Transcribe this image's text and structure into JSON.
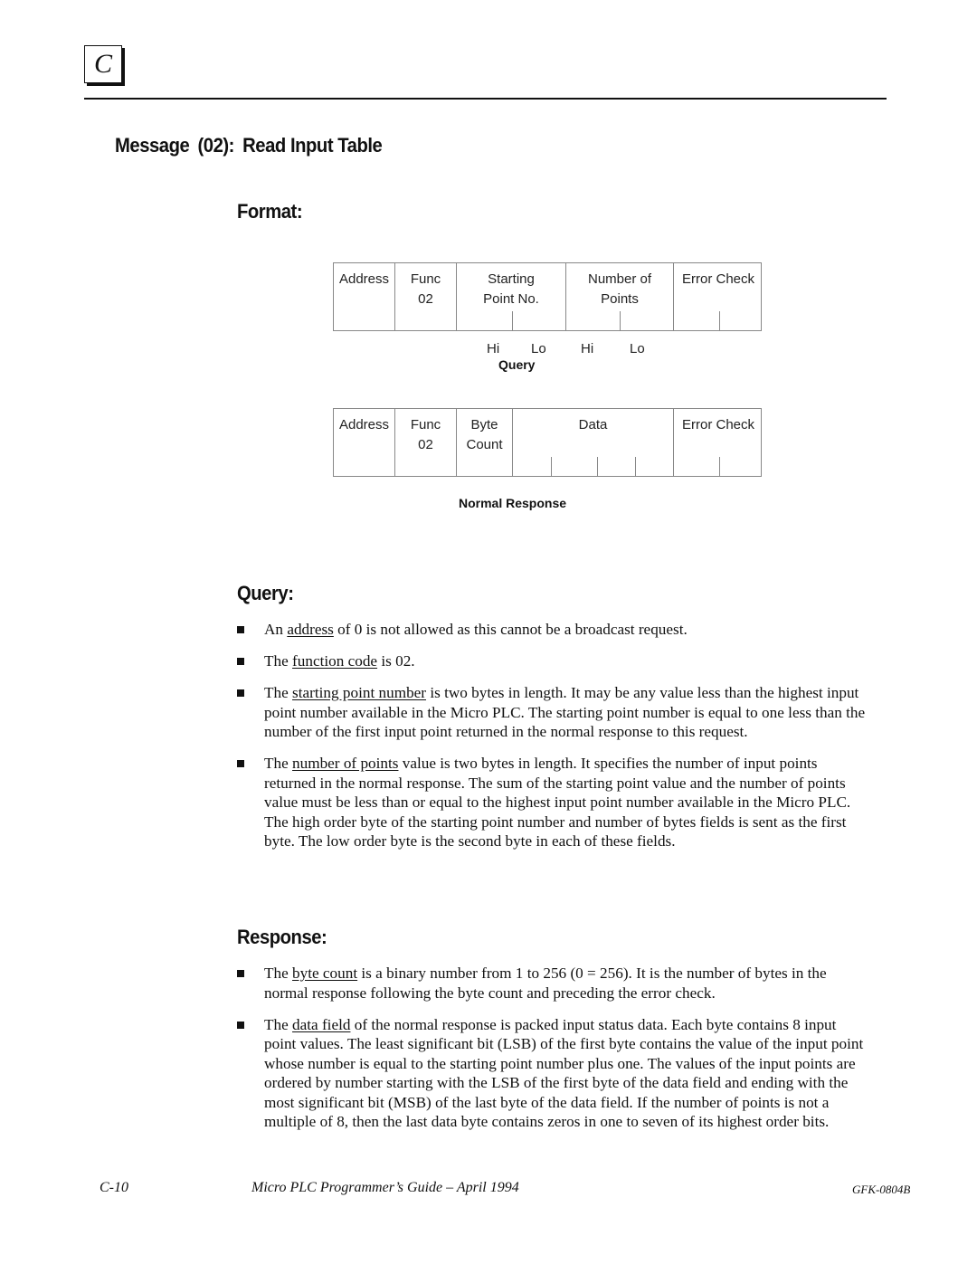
{
  "header": {
    "chapter_letter": "C"
  },
  "title": {
    "part1": "Message",
    "part2": "(02):",
    "part3": "Read Input Table"
  },
  "format_heading": "Format:",
  "query_frame": {
    "cells": [
      {
        "line1": "Address",
        "line2": ""
      },
      {
        "line1": "Func",
        "line2": "02"
      },
      {
        "line1": "Starting",
        "line2": "Point No."
      },
      {
        "line1": "Number of",
        "line2": "Points"
      },
      {
        "line1": "Error Check",
        "line2": ""
      }
    ],
    "byte_labels": [
      "Hi",
      "Lo",
      "Hi",
      "Lo"
    ],
    "caption": "Query"
  },
  "response_frame": {
    "cells": [
      {
        "line1": "Address",
        "line2": ""
      },
      {
        "line1": "Func",
        "line2": "02"
      },
      {
        "line1": "Byte",
        "line2": "Count"
      },
      {
        "line1": "Data",
        "line2": ""
      },
      {
        "line1": "Error Check",
        "line2": ""
      }
    ],
    "caption": "Normal Response"
  },
  "query_section": {
    "heading": "Query:",
    "bullets": [
      {
        "pre": "An ",
        "link": "address",
        "post": " of 0 is not allowed as this cannot be a broadcast request."
      },
      {
        "pre": "The ",
        "link": "function code",
        "post": " is 02."
      },
      {
        "pre": "The ",
        "link": "starting point number",
        "post": " is two bytes in length. It may be any value less than the highest input point number available in the Micro PLC.  The starting point number is equal to one less than the number of the first input point returned in the normal response to this request."
      },
      {
        "pre": "The ",
        "link": "number of points",
        "post": " value is two bytes in length.  It specifies the number of input points returned in the normal response.  The sum of the starting point value and the number of points value must be less than or equal to the highest input point number available in the Micro PLC.  The high order byte of the starting point number and number of bytes fields is sent as the first byte.  The low order byte is the second byte in each of these fields."
      }
    ]
  },
  "response_section": {
    "heading": "Response:",
    "bullets": [
      {
        "pre": "The ",
        "link": "byte count",
        "post": " is a binary number from 1 to 256 (0 = 256).  It is the number of bytes in the normal response following the byte count and preceding the error check."
      },
      {
        "pre": "The ",
        "link": "data field",
        "post": " of the normal response is packed input status data.  Each byte contains 8 input point values.  The least significant bit (LSB) of the first byte contains the value of the input point whose number is equal to the starting point number plus one.  The values of the input points are ordered by number starting with the LSB of the first byte of the data field and ending with the most significant bit (MSB) of the last byte of the data field.  If the number of points is not a multiple of 8, then the last data byte contains zeros in one to seven of its highest order bits."
      }
    ]
  },
  "footer": {
    "page_number": "C-10",
    "book_title": "Micro PLC Programmer’s Guide – April 1994",
    "doc_id": "GFK-0804B"
  }
}
